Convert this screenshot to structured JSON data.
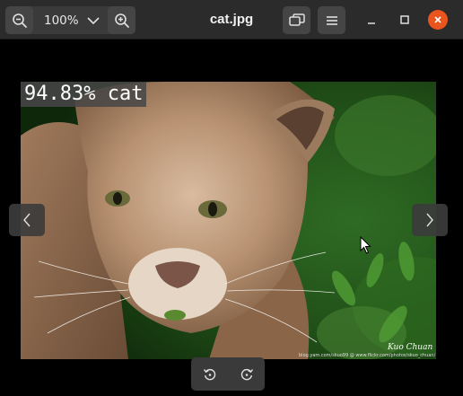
{
  "window": {
    "title": "cat.jpg"
  },
  "toolbar": {
    "zoom_level": "100%",
    "zoom_out_icon": "zoom-out-icon",
    "zoom_in_icon": "zoom-in-icon",
    "zoom_dropdown_icon": "chevron-down-icon",
    "gallery_icon": "gallery-icon",
    "menu_icon": "hamburger-menu-icon",
    "minimize_icon": "minimize-icon",
    "maximize_icon": "maximize-icon",
    "close_icon": "close-icon"
  },
  "image": {
    "overlay_label": "94.83% cat",
    "signature": "Kuo Chuan",
    "credit": "blog.yam.com/skuo99 @ www.flickr.com/photos/skuo_chuan/"
  },
  "navigation": {
    "prev_icon": "chevron-left-icon",
    "next_icon": "chevron-right-icon"
  },
  "rotate": {
    "left_icon": "rotate-left-icon",
    "right_icon": "rotate-right-icon"
  },
  "colors": {
    "titlebar": "#2b2b2b",
    "button": "#454545",
    "close_accent": "#e9541f",
    "viewer_background": "#000000"
  }
}
